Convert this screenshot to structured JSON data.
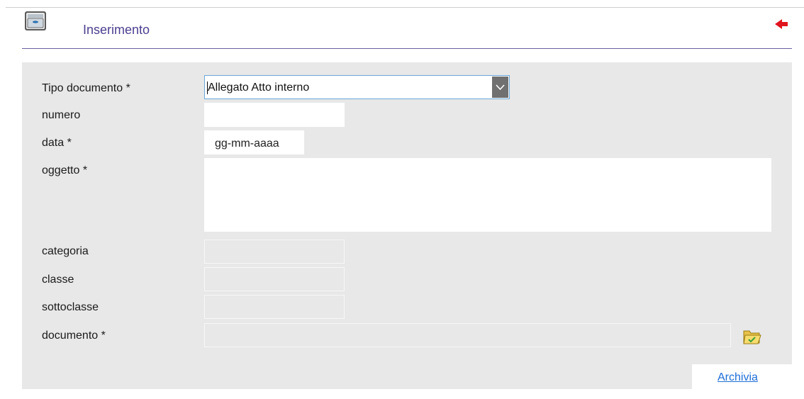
{
  "header": {
    "title": "Inserimento",
    "icon": "drawer-icon",
    "back_icon": "red-arrow-left-icon"
  },
  "form": {
    "tipo_documento": {
      "label": "Tipo documento *",
      "value": "Allegato Atto interno"
    },
    "numero": {
      "label": "numero",
      "value": ""
    },
    "data": {
      "label": "data *",
      "placeholder": "gg-mm-aaaa"
    },
    "oggetto": {
      "label": "oggetto *",
      "value": ""
    },
    "categoria": {
      "label": "categoria",
      "value": ""
    },
    "classe": {
      "label": "classe",
      "value": ""
    },
    "sottoclasse": {
      "label": "sottoclasse",
      "value": ""
    },
    "documento": {
      "label": "documento *",
      "value": "",
      "browse_icon": "open-folder-icon"
    }
  },
  "actions": {
    "archivia": "Archivia"
  },
  "colors": {
    "title": "#4b3f8f",
    "panel": "#e8e8e8",
    "link": "#1e6ed6",
    "accent_red": "#e0141e"
  }
}
